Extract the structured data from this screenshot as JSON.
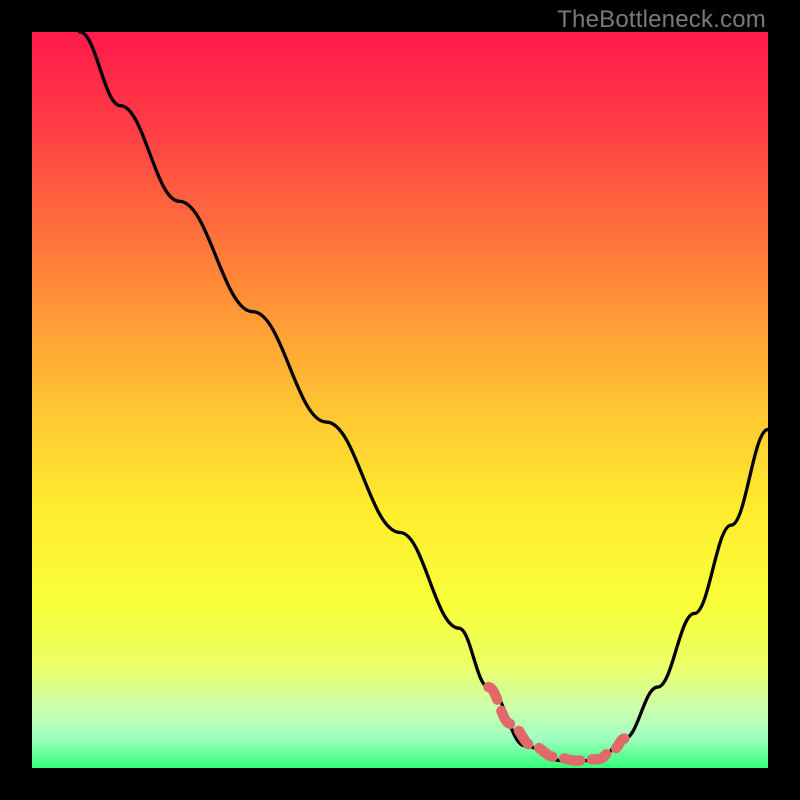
{
  "watermark": "TheBottleneck.com",
  "chart_data": {
    "type": "line",
    "title": "",
    "xlabel": "",
    "ylabel": "",
    "xlim": [
      0,
      100
    ],
    "ylim": [
      0,
      100
    ],
    "gradient_stops": [
      {
        "offset": 0,
        "color": "#ff1a4b"
      },
      {
        "offset": 12,
        "color": "#ff3a45"
      },
      {
        "offset": 30,
        "color": "#ff7a3a"
      },
      {
        "offset": 50,
        "color": "#ffc233"
      },
      {
        "offset": 65,
        "color": "#ffed2e"
      },
      {
        "offset": 78,
        "color": "#f8ff3a"
      },
      {
        "offset": 86,
        "color": "#ecff66"
      },
      {
        "offset": 92,
        "color": "#ccffb0"
      },
      {
        "offset": 96,
        "color": "#9fffbf"
      },
      {
        "offset": 100,
        "color": "#34ff77"
      }
    ],
    "series": [
      {
        "name": "bottleneck-curve",
        "x": [
          6.5,
          12,
          20,
          30,
          40,
          50,
          58,
          62,
          67,
          72,
          77,
          80.5,
          85,
          90,
          95,
          100
        ],
        "values": [
          100,
          90,
          77,
          62,
          47,
          32,
          19,
          11,
          3,
          1,
          1,
          4,
          11,
          21,
          33,
          46
        ]
      }
    ],
    "highlight_segment": {
      "color": "#e06a6a",
      "x": [
        62,
        65,
        68,
        71,
        74,
        77,
        79,
        80.5
      ],
      "values": [
        11,
        6,
        3,
        1.5,
        1,
        1.2,
        2.5,
        4
      ]
    }
  }
}
